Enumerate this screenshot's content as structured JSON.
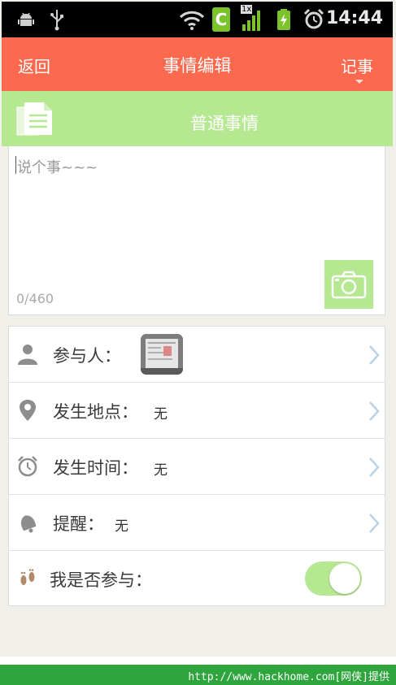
{
  "status_bar": {
    "time": "14:44",
    "icons": [
      "android-icon",
      "usb-icon",
      "wifi-icon",
      "c-app-icon",
      "signal-icon",
      "battery-charging-icon",
      "alarm-icon"
    ],
    "signal_badge": "1x"
  },
  "action_bar": {
    "back_label": "返回",
    "title": "事情编辑",
    "note_label": "记事"
  },
  "category": {
    "icon": "document-icon",
    "label": "普通事情"
  },
  "editor": {
    "placeholder": "说个事~~~",
    "counter": "0/460",
    "camera_icon": "camera-icon"
  },
  "rows": [
    {
      "name": "participants",
      "icon": "person-icon",
      "label": "参与人：",
      "value": ""
    },
    {
      "name": "location",
      "icon": "location-pin-icon",
      "label": "发生地点：",
      "value": "无"
    },
    {
      "name": "time",
      "icon": "alarm-clock-icon",
      "label": "发生时间：",
      "value": "无"
    },
    {
      "name": "reminder",
      "icon": "bell-icon",
      "label": "提醒：",
      "value": "无"
    },
    {
      "name": "self-participate",
      "icon": "footprints-icon",
      "label": "我是否参与：",
      "toggle_on": true
    }
  ],
  "footer": {
    "text": "http://www.hackhome.com[网侠]提供"
  },
  "colors": {
    "action_bar": "#fb6a4f",
    "accent_green": "#b6e892",
    "footer_green": "#2fa53e"
  }
}
